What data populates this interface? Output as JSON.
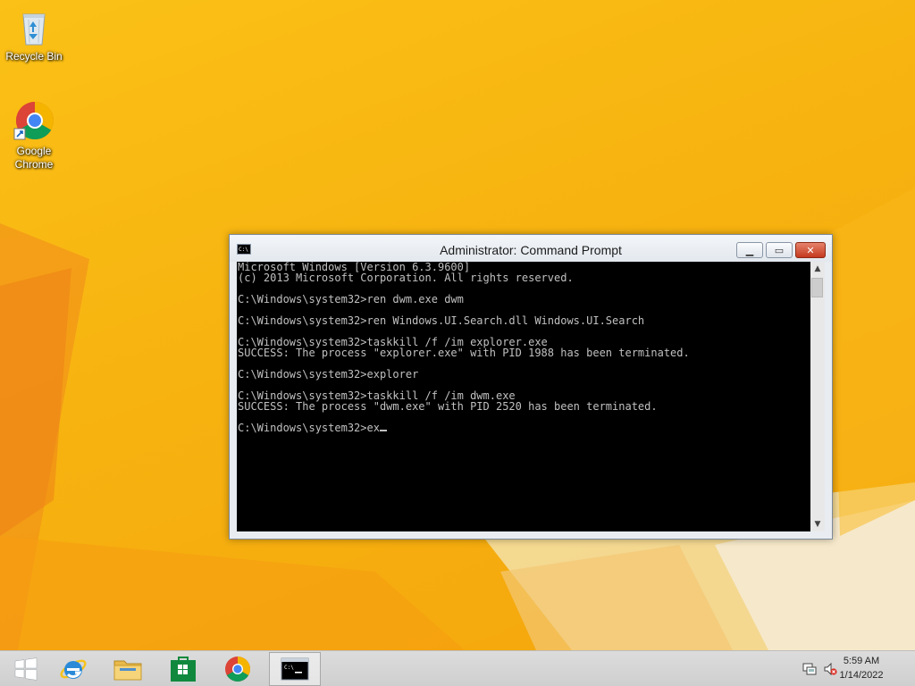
{
  "desktop": {
    "icons": [
      {
        "label": "Recycle Bin",
        "icon": "recycle-bin-icon"
      },
      {
        "label": "Google\nChrome",
        "icon": "chrome-icon"
      }
    ]
  },
  "window": {
    "title": "Administrator: Command Prompt",
    "icon": "console-icon",
    "minimize_glyph": "▁",
    "maximize_glyph": "▭",
    "close_glyph": "✕",
    "console_lines": [
      "Microsoft Windows [Version 6.3.9600]",
      "(c) 2013 Microsoft Corporation. All rights reserved.",
      "",
      "C:\\Windows\\system32>ren dwm.exe dwm",
      "",
      "C:\\Windows\\system32>ren Windows.UI.Search.dll Windows.UI.Search",
      "",
      "C:\\Windows\\system32>taskkill /f /im explorer.exe",
      "SUCCESS: The process \"explorer.exe\" with PID 1988 has been terminated.",
      "",
      "C:\\Windows\\system32>explorer",
      "",
      "C:\\Windows\\system32>taskkill /f /im dwm.exe",
      "SUCCESS: The process \"dwm.exe\" with PID 2520 has been terminated.",
      ""
    ],
    "prompt": "C:\\Windows\\system32>",
    "current_input": "ex",
    "scroll_up_glyph": "▲",
    "scroll_down_glyph": "▼",
    "colors": {
      "console_bg": "#000000",
      "console_fg": "#c0c0c0"
    }
  },
  "taskbar": {
    "items": [
      {
        "name": "start-button",
        "icon": "windows-logo-icon"
      },
      {
        "name": "internet-explorer",
        "icon": "internet-explorer-icon"
      },
      {
        "name": "file-explorer",
        "icon": "folder-icon"
      },
      {
        "name": "store",
        "icon": "store-icon"
      },
      {
        "name": "chrome",
        "icon": "chrome-icon"
      },
      {
        "name": "command-prompt",
        "icon": "console-icon",
        "active": true
      }
    ],
    "tray": {
      "network_icon": "network-icon",
      "volume_icon": "volume-muted-icon",
      "time": "5:59 AM",
      "date": "1/14/2022"
    }
  }
}
